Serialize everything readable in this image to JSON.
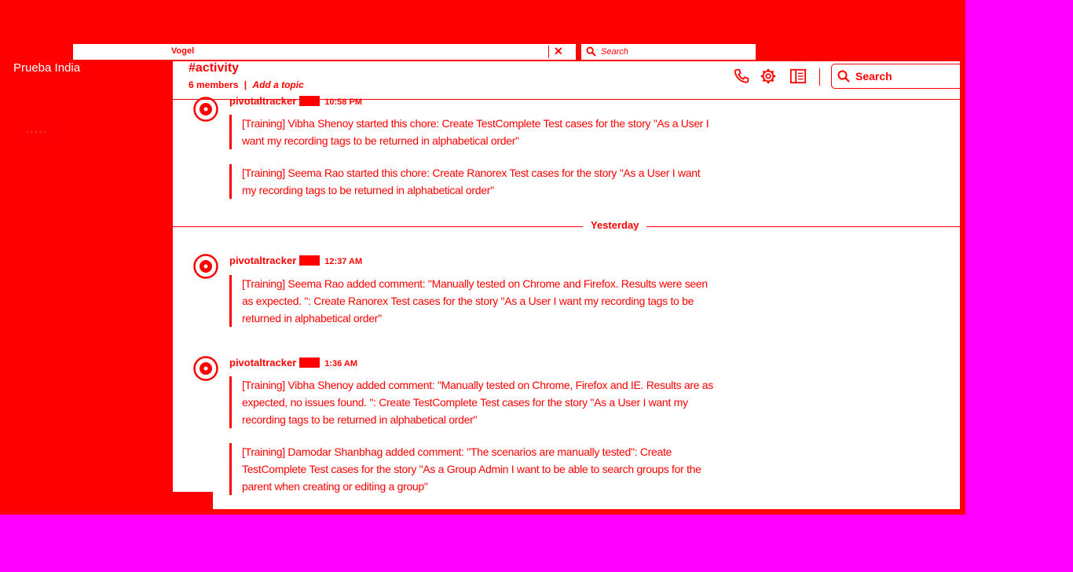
{
  "topbar": {
    "input_value": "Vogel",
    "clear_glyph": "✕",
    "search_label": "Search"
  },
  "workspace": {
    "name": "Prueba India",
    "faint_label": "·····"
  },
  "channel": {
    "name": "#activity",
    "members": "6 members",
    "separator": "|",
    "topic": "Add a topic",
    "search_label": "Search"
  },
  "icons": {
    "call": "phone-icon",
    "settings": "gear-icon",
    "details": "sidebar-toggle-icon",
    "search": "search-icon",
    "avatar": "pivotal-logo-icon"
  },
  "day_divider": "Yesterday",
  "messages": [
    {
      "sender": "pivotaltracker",
      "time": "10:58 PM",
      "attachments": [
        "[Training] Vibha Shenoy started this chore: Create TestComplete Test cases for the story \"As a User I want my recording tags to be returned in alphabetical order\"",
        "[Training] Seema Rao started this chore: Create Ranorex Test cases for the story \"As a User I want my recording tags to be returned in alphabetical order\""
      ]
    },
    {
      "sender": "pivotaltracker",
      "time": "12:37 AM",
      "attachments": [
        "[Training] Seema Rao added comment: \"Manually tested on Chrome and Firefox. Results were seen as expected. \": Create Ranorex Test cases for the story \"As a User I want my recording tags to be returned in alphabetical order\""
      ]
    },
    {
      "sender": "pivotaltracker",
      "time": "1:36 AM",
      "attachments": [
        "[Training] Vibha Shenoy added comment: \"Manually tested on Chrome, Firefox and IE. Results are as expected, no issues found. \": Create TestComplete Test cases for the story \"As a User I want my recording tags to be returned in alphabetical order\"",
        "[Training] Damodar Shanbhag added comment: \"The scenarios are manually tested\": Create TestComplete Test cases for the story \"As a Group Admin I want to be able to search groups for the parent when creating or editing a group\""
      ]
    }
  ],
  "colors": {
    "accent": "#ff0000",
    "background": "#ff00ff",
    "surface": "#ffffff"
  }
}
